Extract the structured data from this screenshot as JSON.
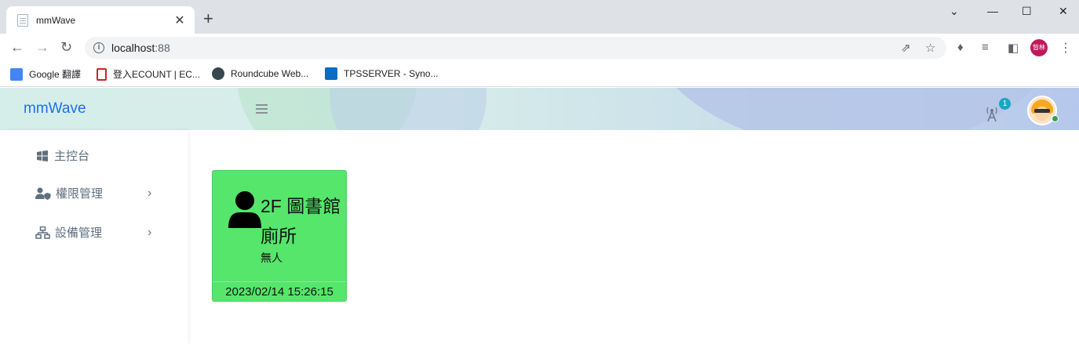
{
  "browser": {
    "tab_title": "mmWave",
    "tab_close": "✕",
    "new_tab": "+",
    "url_host": "localhost",
    "url_port": ":88",
    "window_controls": {
      "minimize": "—",
      "maximize": "☐",
      "close": "✕",
      "tab_search": "⌄"
    },
    "profile_label": "晢林",
    "bookmarks": [
      {
        "label": "Google 翻譯",
        "icon": "google-translate-icon",
        "color": "#4285f4"
      },
      {
        "label": "登入ECOUNT | EC...",
        "icon": "ecount-icon",
        "color": "#c62828"
      },
      {
        "label": "Roundcube Web...",
        "icon": "roundcube-icon",
        "color": "#37474f"
      },
      {
        "label": "TPSSERVER - Syno...",
        "icon": "dsm-icon",
        "color": "#0a6cc2"
      }
    ]
  },
  "app": {
    "brand": "mmWave",
    "notification_count": "1",
    "colors": {
      "brand": "#1a73e8",
      "card_bg": "#55e66b",
      "badge": "#1aa5c7",
      "online": "#2ea44f"
    }
  },
  "sidebar": {
    "items": [
      {
        "label": "主控台",
        "icon": "windows-icon",
        "has_submenu": false
      },
      {
        "label": "權限管理",
        "icon": "user-shield-icon",
        "has_submenu": true
      },
      {
        "label": "設備管理",
        "icon": "network-icon",
        "has_submenu": true
      }
    ]
  },
  "device_card": {
    "name": "2F 圖書館廁所",
    "status": "無人",
    "timestamp": "2023/02/14 15:26:15",
    "icon": "person-icon"
  }
}
